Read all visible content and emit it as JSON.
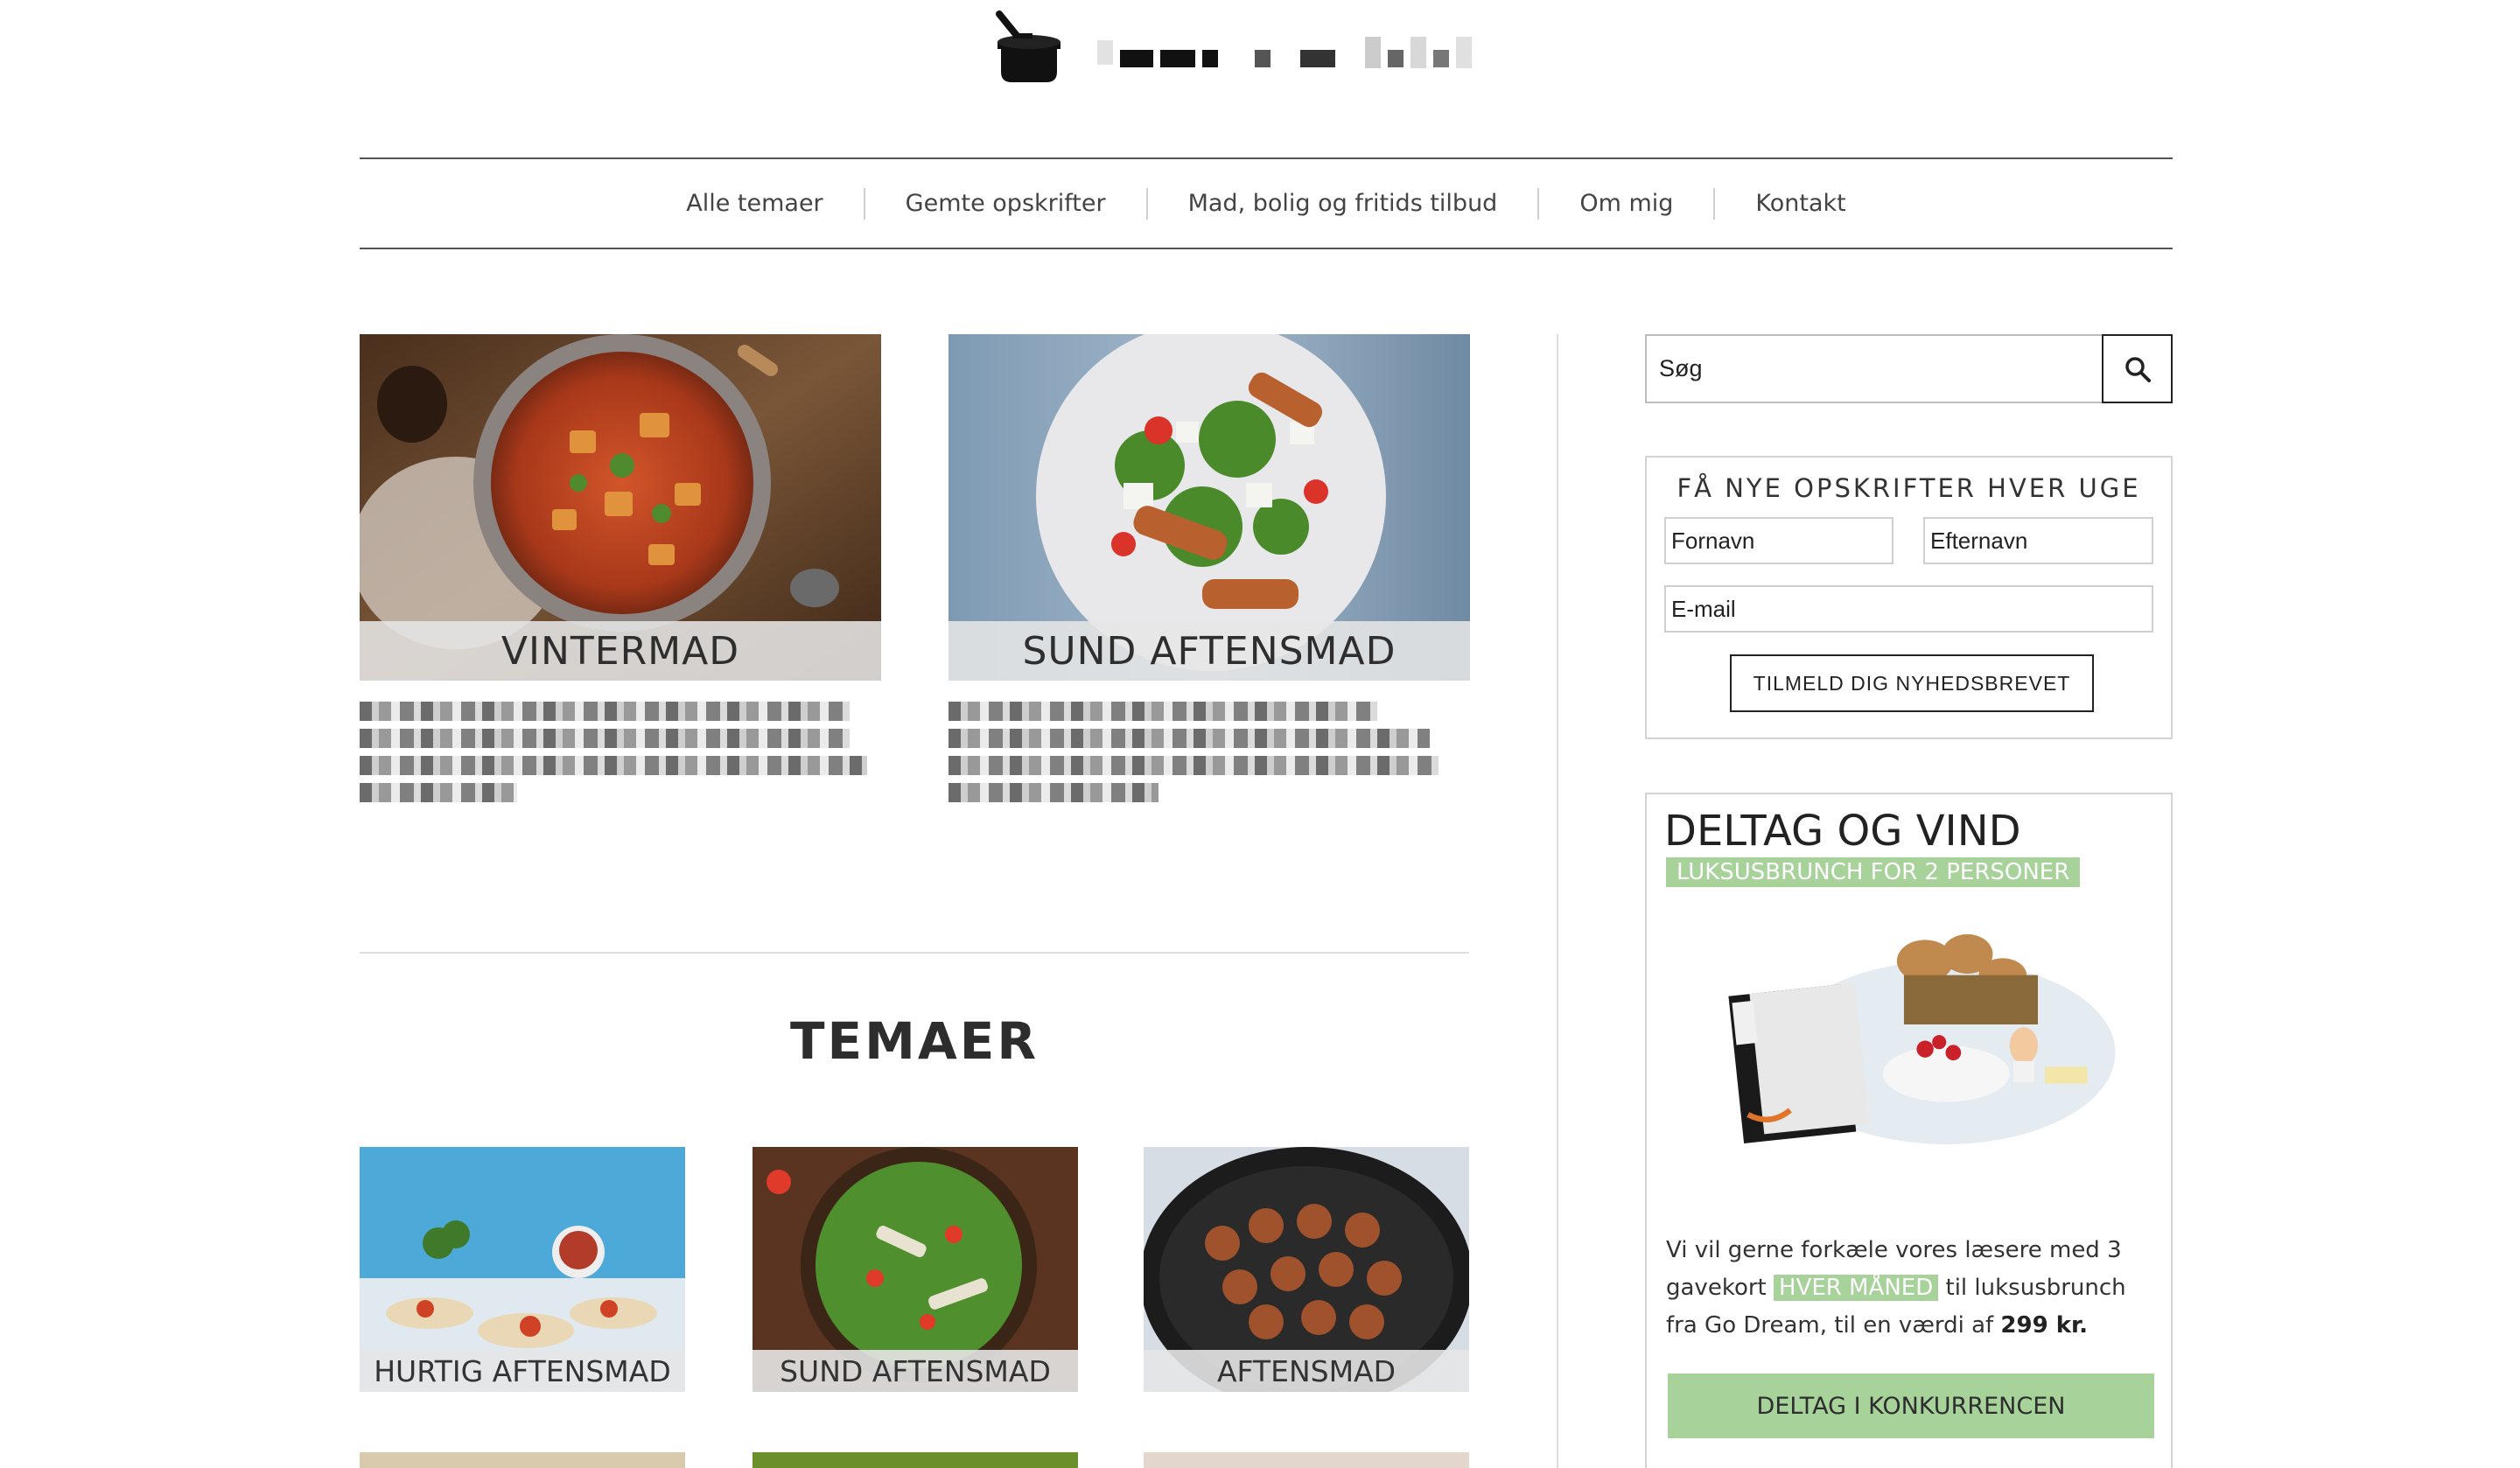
{
  "nav": {
    "items": [
      "Alle temaer",
      "Gemte opskrifter",
      "Mad, bolig og fritids tilbud",
      "Om mig",
      "Kontakt"
    ]
  },
  "features": [
    {
      "label": "VINTERMAD"
    },
    {
      "label": "SUND AFTENSMAD"
    }
  ],
  "themes": {
    "title": "TEMAER",
    "items": [
      {
        "label": "HURTIG AFTENSMAD"
      },
      {
        "label": "SUND AFTENSMAD"
      },
      {
        "label": "AFTENSMAD"
      }
    ]
  },
  "search": {
    "placeholder": "Søg"
  },
  "newsletter": {
    "title": "FÅ NYE OPSKRIFTER HVER UGE",
    "first_name_placeholder": "Fornavn",
    "last_name_placeholder": "Efternavn",
    "email_placeholder": "E-mail",
    "button_label": "TILMELD DIG NYHEDSBREVET"
  },
  "contest": {
    "title": "DELTAG OG VIND",
    "tag": "LUKSUSBRUNCH FOR 2 PERSONER",
    "desc_part1": "Vi vil gerne forkæle vores læsere med 3 gavekort ",
    "desc_highlight": "HVER MÅNED",
    "desc_part2": " til luksusbrunch fra Go Dream, til en værdi af ",
    "desc_price": "299 kr.",
    "button_label": "DELTAG I KONKURRENCEN"
  },
  "colors": {
    "accent_green": "#a7d29a",
    "text_dark": "#333333",
    "border_gray": "#d4d4d4"
  }
}
